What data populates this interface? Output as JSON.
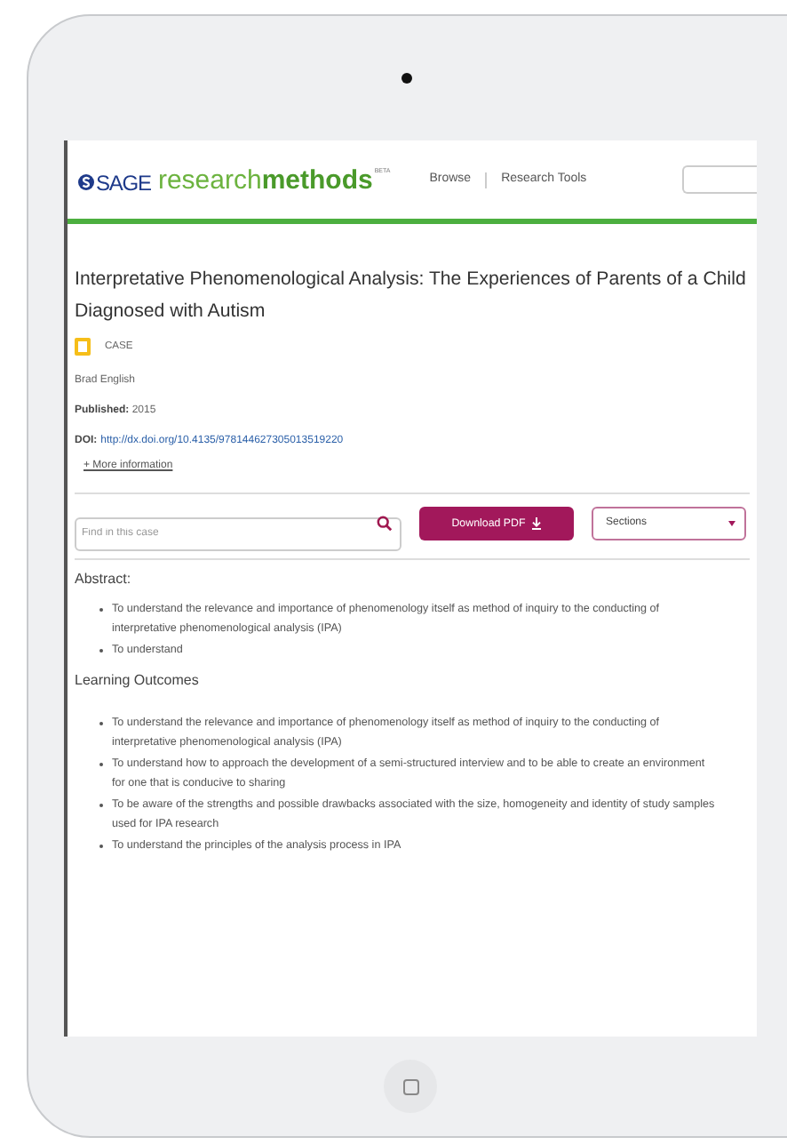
{
  "header": {
    "logo": {
      "brand": "SAGE",
      "light": "research",
      "bold": "methods",
      "tag": "BETA"
    },
    "nav": [
      "Browse",
      "Research Tools"
    ]
  },
  "article": {
    "title": "Interpretative Phenomenological Analysis: The Experiences of Parents of a Child Diagnosed with Autism",
    "type": "CASE",
    "author": "Brad English",
    "published_label": "Published:",
    "published": "2015",
    "doi_label": "DOI:",
    "doi": "http://dx.doi.org/10.4135/978144627305013519220",
    "more": "+ More information"
  },
  "toolbar": {
    "search": {
      "placeholder": "Find in this case"
    },
    "download": "Download PDF",
    "sections": "Sections"
  },
  "abstract": {
    "heading": "Abstract:",
    "items": [
      "To understand the relevance and importance of phenomenology itself as method of inquiry to the conducting of interpretative phenomenological analysis (IPA)",
      "To understand"
    ]
  },
  "outcomes": {
    "heading": "Learning Outcomes",
    "items": [
      "To understand the relevance and importance of phenomenology itself as method of inquiry to the conducting of interpretative phenomenological analysis (IPA)",
      "To understand how to approach the development of a semi-structured interview and to be able to create an environment for one that is conducive to sharing",
      "To be aware of the strengths and possible drawbacks associated with the size, homogeneity and identity of study samples used for IPA research",
      "To understand the principles of the analysis process in IPA"
    ]
  }
}
